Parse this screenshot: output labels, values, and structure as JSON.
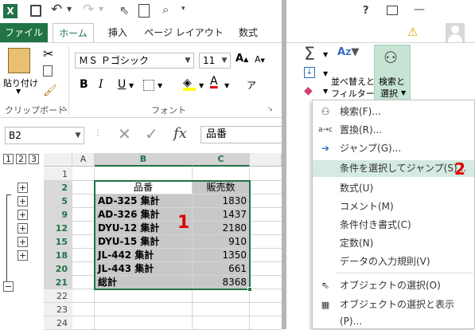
{
  "titlebar": {
    "app_icon": "X",
    "help_label": "?",
    "min_label": "—"
  },
  "tabs": {
    "file": "ファイル",
    "home": "ホーム",
    "insert": "挿入",
    "page_layout": "ページ レイアウト",
    "formulas": "数式"
  },
  "ribbon": {
    "paste_label": "貼り付け",
    "clipboard_label": "クリップボード",
    "font_name": "ＭＳ Ｐゴシック",
    "font_size": "11",
    "bold": "B",
    "italic": "I",
    "underline": "U",
    "font_group_label": "フォント",
    "font_color_label": "A",
    "sort_filter_label_1": "並べ替えと",
    "sort_filter_label_2": "フィルター",
    "find_select_label_1": "検索と",
    "find_select_label_2": "選択"
  },
  "formula_bar": {
    "name_box": "B2",
    "fx": "fx",
    "content": "品番"
  },
  "grid": {
    "outline_levels": [
      "1",
      "2",
      "3"
    ],
    "columns": [
      "A",
      "B",
      "C"
    ],
    "rows": [
      {
        "num": "1",
        "b": "",
        "c": "",
        "selected": false
      },
      {
        "num": "2",
        "b": "品番",
        "c": "販売数",
        "selected": true
      },
      {
        "num": "5",
        "b": "AD-325 集計",
        "c": "1830",
        "selected": true
      },
      {
        "num": "9",
        "b": "AD-326 集計",
        "c": "1437",
        "selected": true
      },
      {
        "num": "12",
        "b": "DYU-12 集計",
        "c": "2180",
        "selected": true
      },
      {
        "num": "15",
        "b": "DYU-15 集計",
        "c": "910",
        "selected": true
      },
      {
        "num": "18",
        "b": "JL-442 集計",
        "c": "1350",
        "selected": true
      },
      {
        "num": "20",
        "b": "JL-443 集計",
        "c": "661",
        "selected": true
      },
      {
        "num": "21",
        "b": "総計",
        "c": "8368",
        "selected": true
      },
      {
        "num": "22",
        "b": "",
        "c": "",
        "selected": false
      },
      {
        "num": "23",
        "b": "",
        "c": "",
        "selected": false
      },
      {
        "num": "24",
        "b": "",
        "c": "",
        "selected": false
      }
    ],
    "annotation_1": "1"
  },
  "menu": {
    "items": [
      {
        "label": "検索(F)...",
        "icon": "binoculars-icon"
      },
      {
        "label": "置換(R)...",
        "icon": "replace-icon"
      },
      {
        "label": "ジャンプ(G)...",
        "icon": "arrow-right-icon"
      },
      {
        "label": "条件を選択してジャンプ(S)...",
        "icon": ""
      },
      {
        "label": "数式(U)",
        "icon": ""
      },
      {
        "label": "コメント(M)",
        "icon": ""
      },
      {
        "label": "条件付き書式(C)",
        "icon": ""
      },
      {
        "label": "定数(N)",
        "icon": ""
      },
      {
        "label": "データの入力規則(V)",
        "icon": ""
      },
      {
        "label": "オブジェクトの選択(O)",
        "icon": "pointer-icon"
      },
      {
        "label": "オブジェクトの選択と表示(P)...",
        "icon": "select-pane-icon"
      }
    ],
    "annotation_2": "2"
  },
  "colors": {
    "excel_green": "#217346",
    "annotation_red": "#e00000",
    "selection_gray": "#c8c8c8",
    "menu_highlight": "#d5eae0"
  }
}
